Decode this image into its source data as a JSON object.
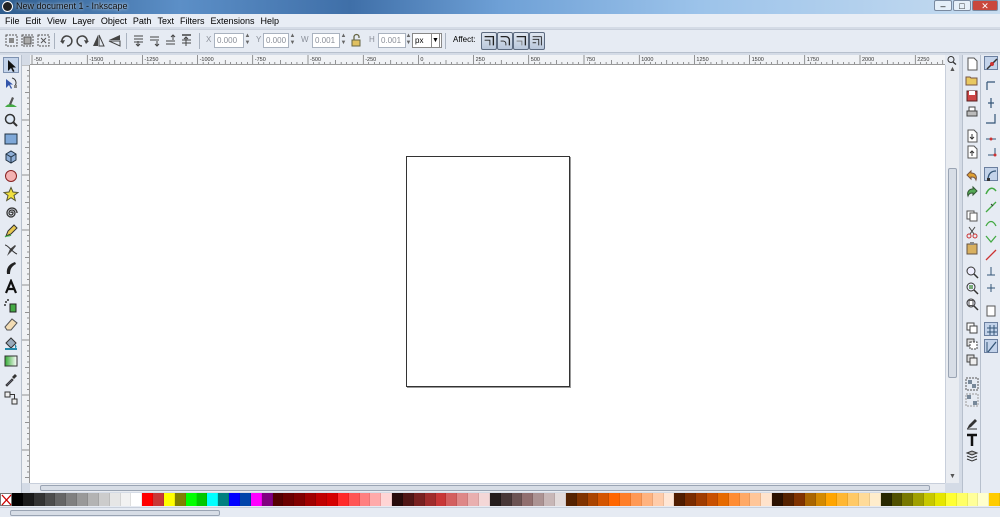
{
  "window": {
    "title": "New document 1 - Inkscape",
    "minimize": "–",
    "maximize": "□",
    "close": "✕"
  },
  "menu": [
    "File",
    "Edit",
    "View",
    "Layer",
    "Object",
    "Path",
    "Text",
    "Filters",
    "Extensions",
    "Help"
  ],
  "toolbar": {
    "x_label": "X",
    "x_value": "0.000",
    "y_label": "Y",
    "y_value": "0.000",
    "w_label": "W",
    "w_value": "0.001",
    "h_label": "H",
    "h_value": "0.001",
    "unit": "px",
    "affect_label": "Affect:"
  },
  "rulers": {
    "horizontal_labels": [
      "-50",
      "-1500",
      "-1250",
      "-1000",
      "-750",
      "-500",
      "-250",
      "0",
      "250",
      "500",
      "750",
      "1000",
      "1250",
      "1500",
      "1750",
      "2000",
      "2250"
    ]
  },
  "palette": [
    "#000000",
    "#1a1a1a",
    "#333333",
    "#4d4d4d",
    "#666666",
    "#808080",
    "#999999",
    "#b3b3b3",
    "#cccccc",
    "#e6e6e6",
    "#f2f2f2",
    "#ffffff",
    "#ff0000",
    "#c83737",
    "#ffff00",
    "#808000",
    "#00ff00",
    "#00c800",
    "#00ffff",
    "#008080",
    "#0000ff",
    "#0044aa",
    "#ff00ff",
    "#800080",
    "#550000",
    "#6b0000",
    "#800000",
    "#a00000",
    "#c00000",
    "#d40000",
    "#ff2a2a",
    "#ff5555",
    "#ff8080",
    "#ffaaaa",
    "#ffd5d5",
    "#280b0b",
    "#501616",
    "#782121",
    "#a02c2c",
    "#c83737",
    "#d35f5f",
    "#de8787",
    "#e9afaf",
    "#f4d7d7",
    "#241c1c",
    "#483737",
    "#6c5353",
    "#916f6f",
    "#ac9393",
    "#c8b7b7",
    "#e3dbdb",
    "#552200",
    "#803300",
    "#aa4400",
    "#d45500",
    "#ff6600",
    "#ff7f2a",
    "#ff9955",
    "#ffb380",
    "#ffccaa",
    "#ffe6d5",
    "#501d00",
    "#7a2c00",
    "#a03c00",
    "#c85000",
    "#e66a00",
    "#ff8c33",
    "#ffa966",
    "#ffc699",
    "#ffe3cc",
    "#2b1100",
    "#552200",
    "#803300",
    "#aa6600",
    "#d48a00",
    "#ffa500",
    "#ffb733",
    "#ffc966",
    "#ffdb99",
    "#ffedcc",
    "#282800",
    "#505000",
    "#787800",
    "#a0a000",
    "#c8c800",
    "#e6e600",
    "#ffff33",
    "#ffff66",
    "#ffff99",
    "#ffffcc",
    "#ffcc00"
  ]
}
